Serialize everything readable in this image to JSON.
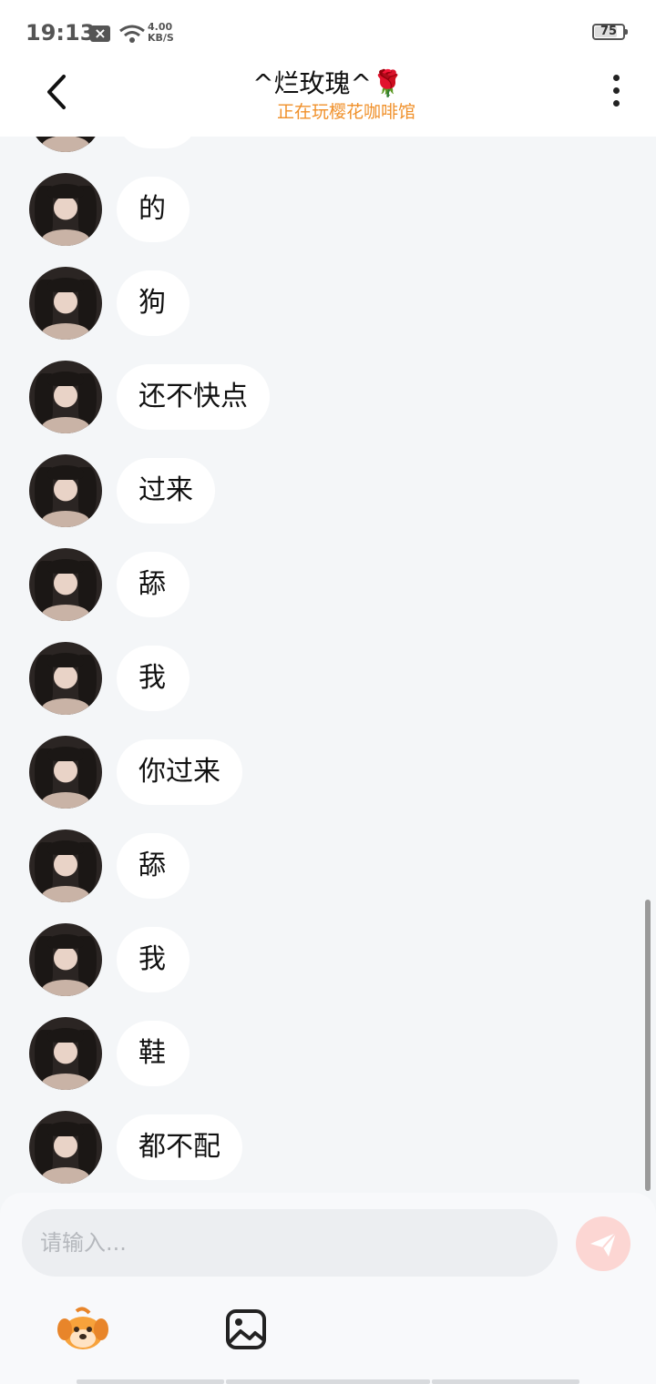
{
  "status_bar": {
    "time": "19:13",
    "notification_icon": "x-icon",
    "net_speed_value": "4.00",
    "net_speed_unit": "KB/S",
    "battery_level": "75"
  },
  "header": {
    "title": "^烂玫瑰^🌹",
    "subtitle": "正在玩樱花咖啡馆",
    "subtitle_color": "#f0902a"
  },
  "messages": [
    {
      "text": "的"
    },
    {
      "text": "狗"
    },
    {
      "text": "还不快点"
    },
    {
      "text": "过来"
    },
    {
      "text": "舔"
    },
    {
      "text": "我"
    },
    {
      "text": "你过来"
    },
    {
      "text": "舔"
    },
    {
      "text": "我"
    },
    {
      "text": "鞋"
    },
    {
      "text": "都不配"
    }
  ],
  "composer": {
    "placeholder": "请输入...",
    "send_icon": "paper-plane-icon",
    "emoji_icon": "dog-emoji-icon",
    "image_icon": "image-icon",
    "send_color": "#fcd6d3"
  }
}
